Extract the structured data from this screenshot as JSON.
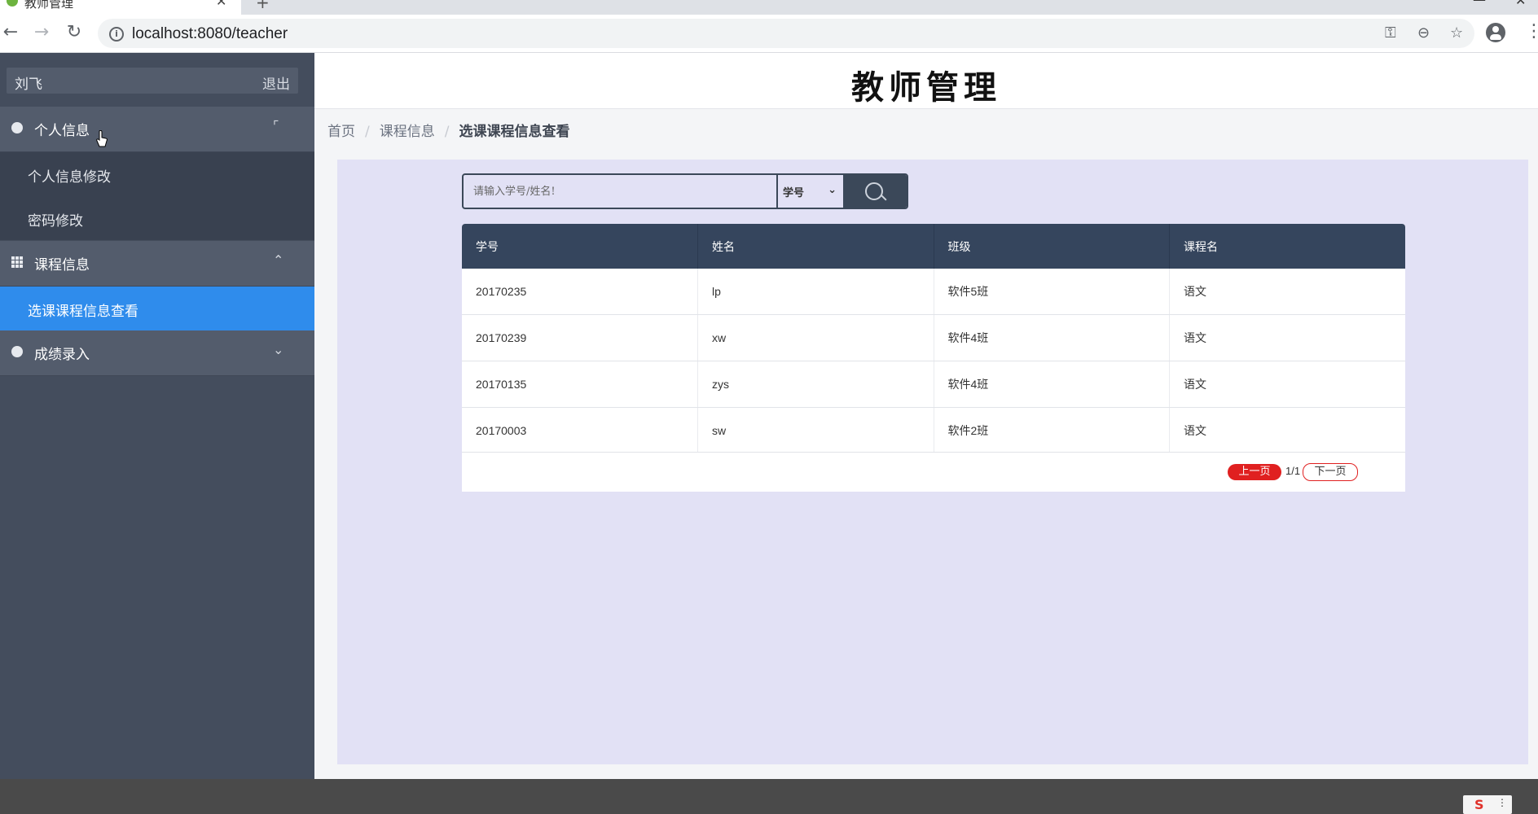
{
  "browser": {
    "tab_title": "教师管理",
    "url": "localhost:8080/teacher"
  },
  "user": {
    "name": "刘飞",
    "logout_label": "退出"
  },
  "sidebar": {
    "sections": [
      {
        "label": "个人信息",
        "expanded": true,
        "items": [
          "个人信息修改",
          "密码修改"
        ]
      },
      {
        "label": "课程信息",
        "expanded": true,
        "items": [
          "选课课程信息查看"
        ],
        "active_item": "选课课程信息查看"
      },
      {
        "label": "成绩录入",
        "expanded": false,
        "items": []
      }
    ]
  },
  "header": {
    "title": "教师管理"
  },
  "breadcrumb": [
    "首页",
    "课程信息",
    "选课课程信息查看"
  ],
  "search": {
    "placeholder": "请输入学号/姓名!",
    "field_selected": "学号"
  },
  "table": {
    "columns": [
      "学号",
      "姓名",
      "班级",
      "课程名"
    ],
    "rows": [
      [
        "20170235",
        "lp",
        "软件5班",
        "语文"
      ],
      [
        "20170239",
        "xw",
        "软件4班",
        "语文"
      ],
      [
        "20170135",
        "zys",
        "软件4班",
        "语文"
      ],
      [
        "20170003",
        "sw",
        "软件2班",
        "语文"
      ]
    ]
  },
  "pagination": {
    "prev_label": "上一页",
    "page_info": "1/1",
    "next_label": "下一页"
  },
  "colors": {
    "sidebar_bg": "#444d5d",
    "active_item": "#2f8cec",
    "table_header": "#35455d",
    "content_bg": "#e2e1f5",
    "prev_button": "#e02020"
  }
}
